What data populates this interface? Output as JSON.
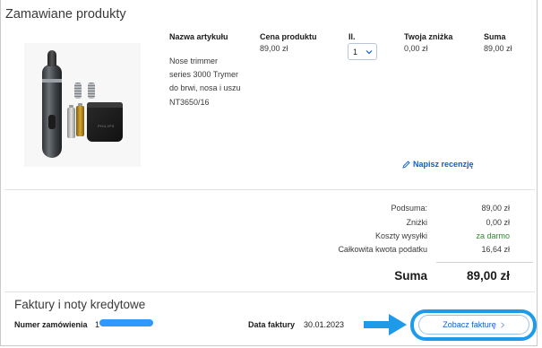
{
  "section": {
    "title": "Zamawiane produkty"
  },
  "table": {
    "headers": {
      "name": "Nazwa artykułu",
      "price": "Cena produktu",
      "qty": "Il.",
      "discount": "Twoja zniżka",
      "total": "Suma"
    },
    "row": {
      "name": "Nose trimmer series 3000 Trymer do brwi, nosa i uszu NT3650/16",
      "price": "89,00 zł",
      "qty": "1",
      "discount": "0,00 zł",
      "total": "89,00 zł",
      "image_logo": "PHILIPS"
    }
  },
  "review_link": "Napisz recenzję",
  "summary": {
    "subtotal_label": "Podsuma:",
    "subtotal_value": "89,00 zł",
    "discounts_label": "Zniżki",
    "discounts_value": "0,00 zł",
    "shipping_label": "Koszty wysyłki",
    "shipping_value": "za darmo",
    "tax_label": "Całkowita kwota podatku",
    "tax_value": "16,64 zł",
    "grand_label": "Suma",
    "grand_value": "89,00 zł"
  },
  "invoices": {
    "title": "Faktury i noty kredytowe",
    "order_label": "Numer zamówienia",
    "order_value": "1",
    "date_label": "Data faktury",
    "date_value": "30.01.2023",
    "button_label": "Zobacz fakturę"
  },
  "colors": {
    "link": "#0b5ed7",
    "free_shipping": "#2e8b2e",
    "highlight": "#1e9be8"
  },
  "icons": {
    "qty": "chevron-down-icon",
    "review": "pencil-icon",
    "arrow": "arrow-right-icon",
    "button": "chevron-right-icon"
  }
}
